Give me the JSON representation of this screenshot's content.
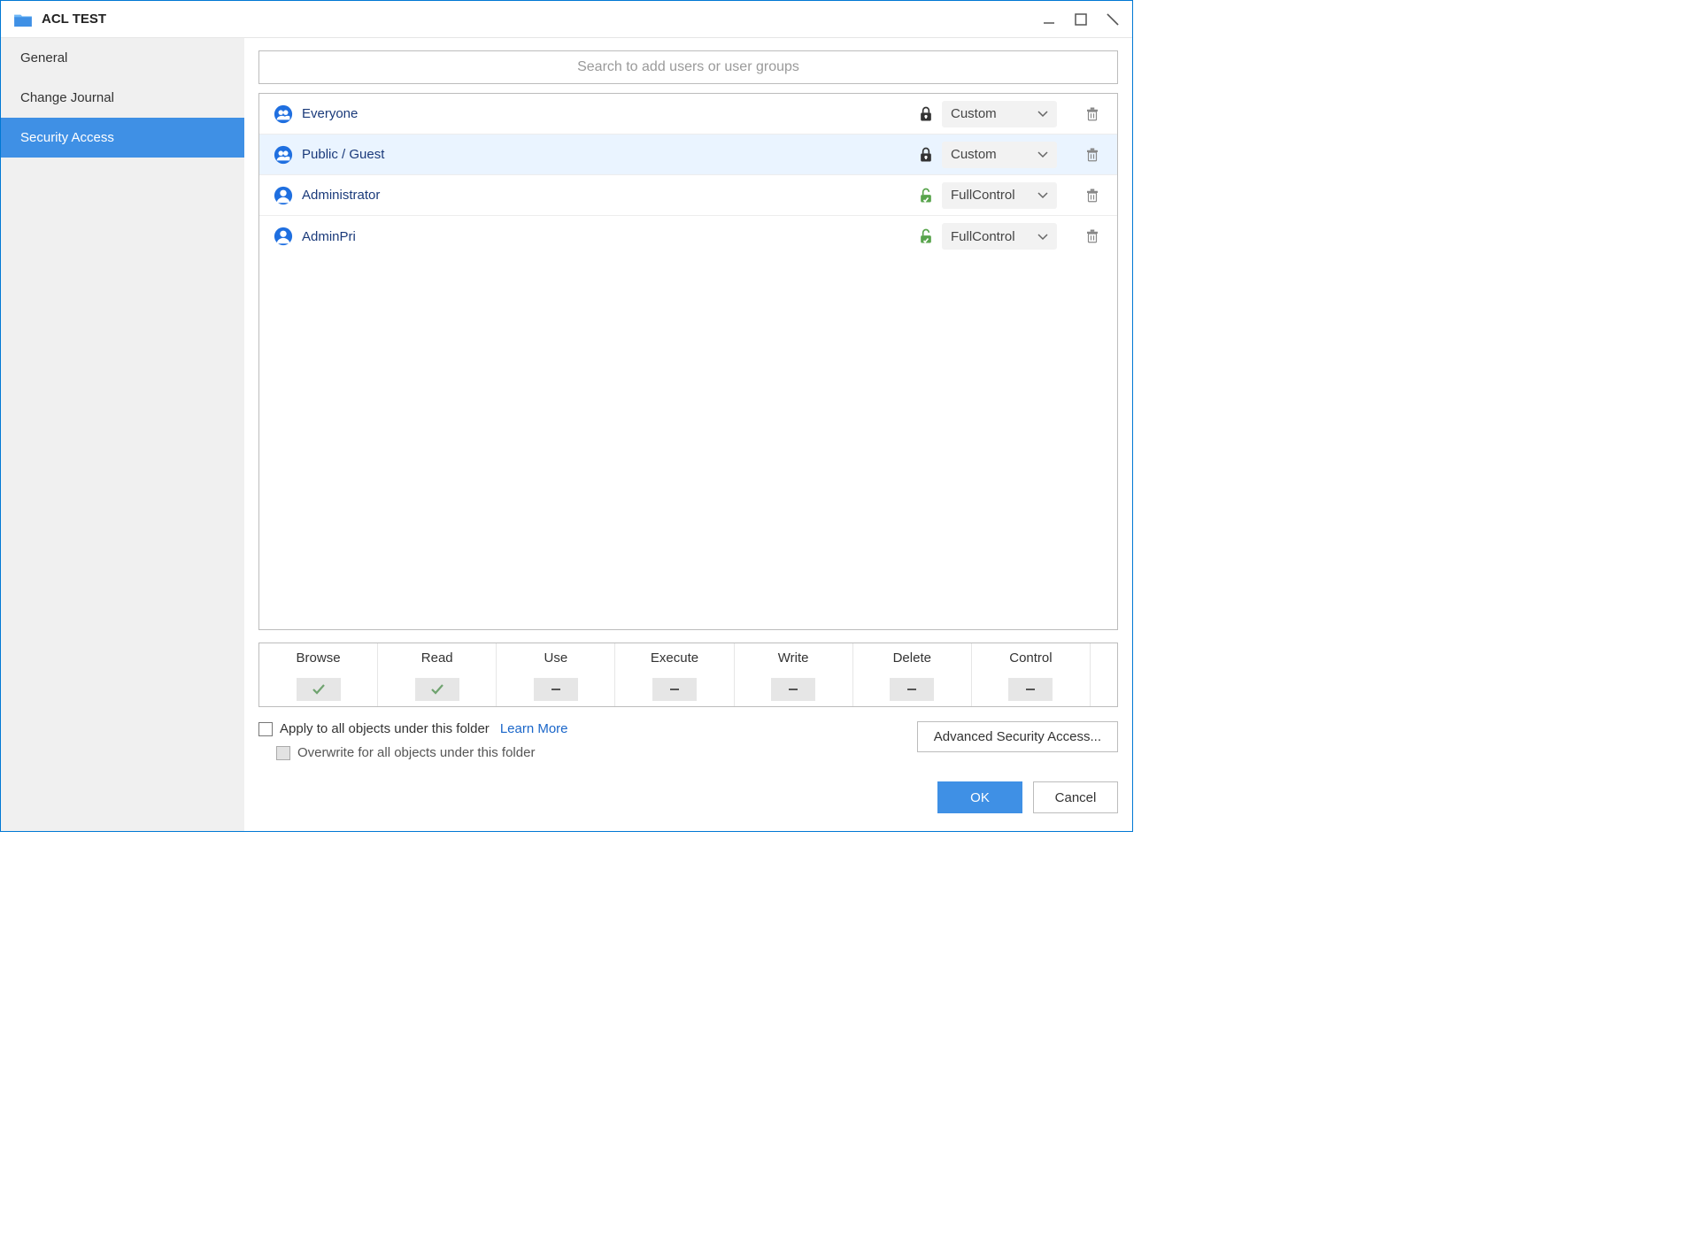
{
  "window": {
    "title": "ACL TEST"
  },
  "sidebar": {
    "items": [
      {
        "label": "General",
        "active": false
      },
      {
        "label": "Change Journal",
        "active": false
      },
      {
        "label": "Security Access",
        "active": true
      }
    ]
  },
  "search": {
    "placeholder": "Search to add users or user groups"
  },
  "acl": [
    {
      "name": "Everyone",
      "type": "group",
      "lock": "locked",
      "permission": "Custom",
      "selected": false
    },
    {
      "name": "Public / Guest",
      "type": "group",
      "lock": "locked",
      "permission": "Custom",
      "selected": true
    },
    {
      "name": "Administrator",
      "type": "user",
      "lock": "open",
      "permission": "FullControl",
      "selected": false
    },
    {
      "name": "AdminPri",
      "type": "user",
      "lock": "open",
      "permission": "FullControl",
      "selected": false
    }
  ],
  "permissions_table": {
    "headers": [
      "Browse",
      "Read",
      "Use",
      "Execute",
      "Write",
      "Delete",
      "Control"
    ],
    "values": [
      "check",
      "check",
      "dash",
      "dash",
      "dash",
      "dash",
      "dash"
    ]
  },
  "options": {
    "apply_all_label": "Apply to all objects under this folder",
    "learn_more_label": "Learn More",
    "overwrite_label": "Overwrite for all objects under this folder"
  },
  "buttons": {
    "advanced": "Advanced Security Access...",
    "ok": "OK",
    "cancel": "Cancel"
  }
}
